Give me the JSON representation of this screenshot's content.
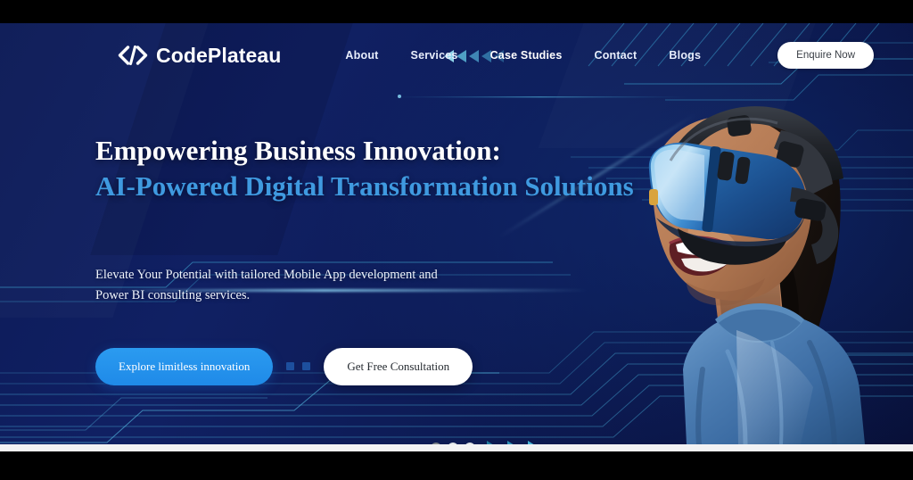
{
  "brand": {
    "name": "CodePlateau",
    "logo_icon": "code-brackets-icon",
    "logo_glyph": "</>"
  },
  "nav": {
    "items": [
      {
        "label": "About",
        "name": "about",
        "active": false
      },
      {
        "label": "Services",
        "name": "services",
        "active": false
      },
      {
        "label": "Case Studies",
        "name": "case-studies",
        "active": true
      },
      {
        "label": "Contact",
        "name": "contact",
        "active": false
      },
      {
        "label": "Blogs",
        "name": "blogs",
        "active": false
      }
    ],
    "cta_label": "Enquire Now",
    "decorative_arrows": {
      "icon": "triangle-left-icon",
      "count": 5,
      "colors": [
        "#8fd3e8",
        "#4f9fc4",
        "#3f86b4",
        "#2f6fa2",
        "#24548a"
      ]
    }
  },
  "hero": {
    "headline_line1": "Empowering Business Innovation:",
    "headline_line2": "AI-Powered Digital Transformation Solutions",
    "subtext_line1": "Elevate Your Potential with tailored Mobile App development and",
    "subtext_line2": "Power BI consulting services.",
    "primary_cta": "Explore limitless innovation",
    "secondary_cta": "Get Free Consultation",
    "image_alt": "woman-wearing-vr-headset",
    "separator_squares": 2
  },
  "carousel": {
    "dots": [
      {
        "state": "active"
      },
      {
        "state": "idle"
      },
      {
        "state": "idle"
      }
    ],
    "arrows": {
      "icon": "triangle-right-icon",
      "count": 3,
      "colors": [
        "#1f7a9e",
        "#2d90b8",
        "#45b2d6"
      ]
    }
  },
  "colors": {
    "accent_blue": "#3f9ae0",
    "button_blue": "#2b9bf0",
    "background_navy": "#0c1a57",
    "circuit_cyan": "#2e9fd0",
    "text_white": "#ffffff",
    "letterbox_black": "#000000"
  }
}
